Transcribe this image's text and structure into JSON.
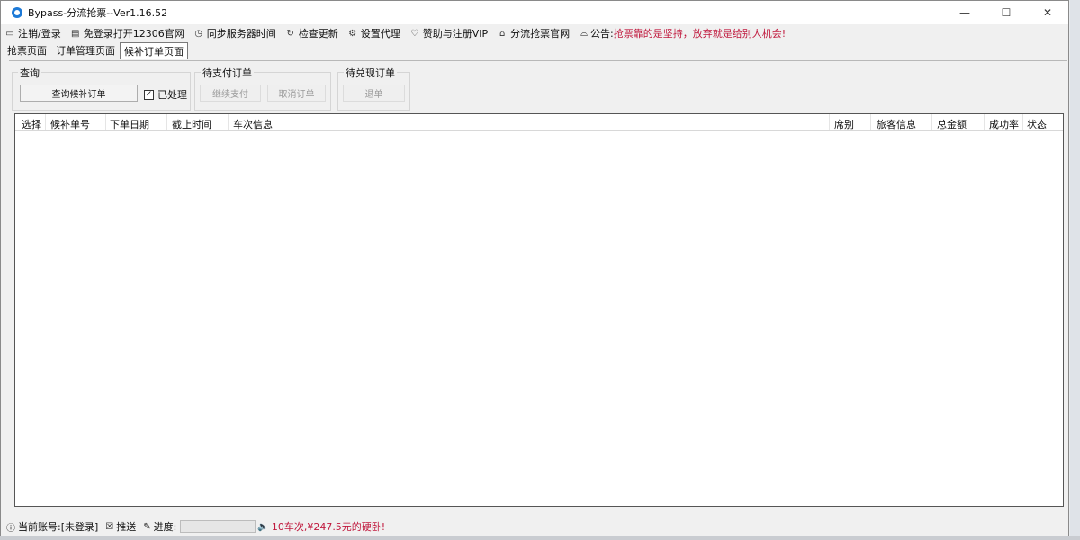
{
  "window": {
    "title": "Bypass-分流抢票--Ver1.16.52",
    "controls": {
      "minimize": "—",
      "maximize": "☐",
      "close": "✕"
    }
  },
  "menu": {
    "items": [
      {
        "label": "注销/登录",
        "icon": "monitor-icon"
      },
      {
        "label": "免登录打开12306官网",
        "icon": "browser-icon"
      },
      {
        "label": "同步服务器时间",
        "icon": "clock-icon"
      },
      {
        "label": "检查更新",
        "icon": "refresh-icon"
      },
      {
        "label": "设置代理",
        "icon": "gear-icon"
      },
      {
        "label": "赞助与注册VIP",
        "icon": "heart-icon"
      },
      {
        "label": "分流抢票官网",
        "icon": "home-icon"
      }
    ],
    "notice_label": "公告:",
    "notice_text": "抢票靠的是坚持，放弃就是给别人机会!"
  },
  "tabs": [
    {
      "label": "抢票页面"
    },
    {
      "label": "订单管理页面"
    },
    {
      "label": "候补订单页面"
    }
  ],
  "groups": {
    "query": {
      "title": "查询",
      "button": "查询候补订单",
      "checkbox_label": "已处理",
      "checked": true
    },
    "pending_pay": {
      "title": "待支付订单",
      "continue_pay": "继续支付",
      "cancel_order": "取消订单"
    },
    "pending_redeem": {
      "title": "待兑现订单",
      "refund": "退单"
    }
  },
  "table": {
    "columns": [
      "选择",
      "候补单号",
      "下单日期",
      "截止时间",
      "车次信息",
      "席别",
      "旅客信息",
      "总金额",
      "成功率",
      "状态"
    ],
    "rows": []
  },
  "status": {
    "account": "当前账号:[未登录]",
    "push": "推送",
    "progress_label": "进度:",
    "progress_value": 0,
    "promo": "10车次,¥247.5元的硬卧!"
  },
  "colors": {
    "accent": "#1e7ad7",
    "notice": "#c0183d"
  }
}
